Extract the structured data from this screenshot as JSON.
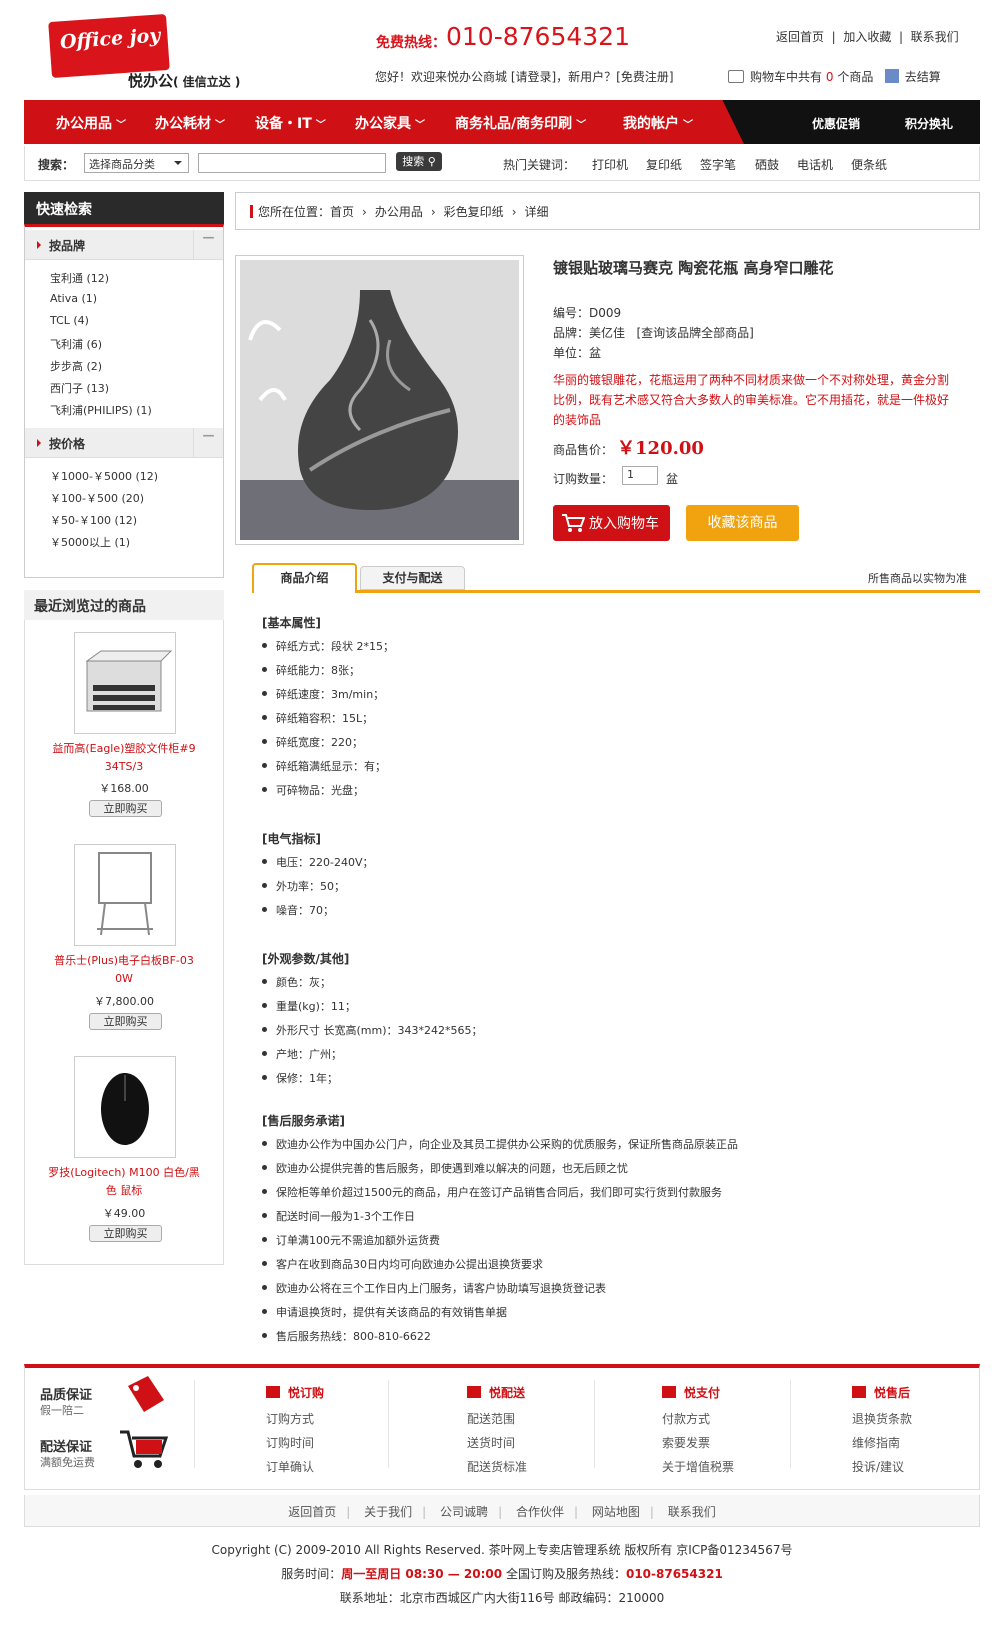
{
  "header": {
    "logo_text": "Office joy",
    "brand": "悦办公",
    "brand_sub": "( 佳信立达 )",
    "hotline_label": "免费热线：",
    "hotline": "010-87654321",
    "top_links": [
      "返回首页",
      "加入收藏",
      "联系我们"
    ],
    "welcome": "您好！欢迎来悦办公商城 [请登录]，新用户？[免费注册]",
    "cart_prefix": "购物车中共有",
    "cart_count": "0",
    "cart_suffix": "个商品",
    "checkout": "去结算"
  },
  "nav": {
    "items": [
      "办公用品",
      "办公耗材",
      "设备・IT",
      "办公家具",
      "商务礼品/商务印刷",
      "我的帐户"
    ],
    "right": [
      "优惠促销",
      "积分换礼"
    ]
  },
  "search": {
    "label": "搜索：",
    "select": "选择商品分类",
    "button": "搜索",
    "hot_label": "热门关键词：",
    "hot": [
      "打印机",
      "复印纸",
      "签字笔",
      "硒鼓",
      "电话机",
      "便条纸"
    ]
  },
  "sidebar": {
    "quick": "快速检索",
    "brand_title": "按品牌",
    "brands": [
      "宝利通 (12)",
      "Ativa (1)",
      "TCL (4)",
      "飞利浦 (6)",
      "步步高 (2)",
      "西门子 (13)",
      "飞利浦(PHILIPS) (1)"
    ],
    "price_title": "按价格",
    "prices": [
      "￥1000-￥5000 (12)",
      "￥100-￥500 (20)",
      "￥50-￥100 (12)",
      "￥5000以上 (1)"
    ],
    "recent_title": "最近浏览过的商品",
    "recent": [
      {
        "name": "益而高(Eagle)塑胶文件柜#9 34TS/3",
        "price": "￥168.00",
        "btn": "立即购买"
      },
      {
        "name": "普乐士(Plus)电子白板BF-03 0W",
        "price": "￥7,800.00",
        "btn": "立即购买"
      },
      {
        "name": "罗技(Logitech) M100 白色/黑色 鼠标",
        "price": "￥49.00",
        "btn": "立即购买"
      }
    ]
  },
  "breadcrumb": {
    "prefix": "您所在位置：",
    "items": [
      "首页",
      "办公用品",
      "彩色复印纸",
      "详细"
    ]
  },
  "product": {
    "title": "镀银贴玻璃马赛克 陶瓷花瓶 高身窄口雕花",
    "code": "编号：D009",
    "brand": "品牌：美亿佳",
    "brand_link": "[查询该品牌全部商品]",
    "unit": "单位：盆",
    "desc": "华丽的镀银雕花，花瓶运用了两种不同材质来做一个不对称处理，黄金分割比例，既有艺术感又符合大多数人的审美标准。它不用插花，就是一件极好的装饰品",
    "price_label": "商品售价：",
    "price": "￥120.00",
    "qty_label": "订购数量：",
    "qty": "1",
    "qty_unit": "盆",
    "cart_btn": "放入购物车",
    "fav_btn": "收藏该商品"
  },
  "tabs": {
    "t1": "商品介绍",
    "t2": "支付与配送",
    "note": "所售商品以实物为准"
  },
  "specs": [
    {
      "title": "[基本属性]",
      "items": [
        "碎纸方式：段状 2*15；",
        "碎纸能力：8张；",
        "碎纸速度：3m/min；",
        "碎纸箱容积：15L；",
        "碎纸宽度：220；",
        "碎纸箱满纸显示：有；",
        "可碎物品：光盘；"
      ]
    },
    {
      "title": "[电气指标]",
      "items": [
        "电压：220-240V；",
        "外功率：50；",
        "噪音：70；"
      ]
    },
    {
      "title": "[外观参数/其他]",
      "items": [
        "颜色：灰；",
        "重量(kg)：11；",
        "外形尺寸 长宽高(mm)：343*242*565；",
        "产地：广州；",
        "保修：1年；"
      ]
    },
    {
      "title": "[售后服务承诺]",
      "items": [
        "欧迪办公作为中国办公门户，向企业及其员工提供办公采购的优质服务，保证所售商品原装正品",
        "欧迪办公提供完善的售后服务，即使遇到难以解决的问题，也无后顾之忧",
        "保险柜等单价超过1500元的商品，用户在签订产品销售合同后，我们即可实行货到付款服务",
        "配送时间一般为1-3个工作日",
        "订单满100元不需追加额外运货费",
        "客户在收到商品30日内均可向欧迪办公提出退换货要求",
        "欧迪办公将在三个工作日内上门服务，请客户协助填写退换货登记表",
        "申请退换货时，提供有关该商品的有效销售单据",
        "售后服务热线：800-810-6622"
      ]
    }
  ],
  "guarantee": {
    "quality": "品质保证",
    "quality_sub": "假一陪二",
    "delivery": "配送保证",
    "delivery_sub": "满额免运费"
  },
  "footer_cols": [
    {
      "title": "悦订购",
      "items": [
        "订购方式",
        "订购时间",
        "订单确认"
      ]
    },
    {
      "title": "悦配送",
      "items": [
        "配送范围",
        "送货时间",
        "配送货标准"
      ]
    },
    {
      "title": "悦支付",
      "items": [
        "付款方式",
        "索要发票",
        "关于增值税票"
      ]
    },
    {
      "title": "悦售后",
      "items": [
        "退换货条款",
        "维修指南",
        "投诉/建议"
      ]
    }
  ],
  "footer_nav": [
    "返回首页",
    "关于我们",
    "公司诚聘",
    "合作伙伴",
    "网站地图",
    "联系我们"
  ],
  "copyright": "Copyright (C) 2009-2010 All Rights Reserved. 茶叶网上专卖店管理系统 版权所有  京ICP备01234567号",
  "service_label": "服务时间：",
  "service_time": "周一至周日 08:30 — 20:00",
  "service_mid": " 全国订购及服务热线：",
  "service_phone": "010-87654321",
  "address": "联系地址：北京市西城区广内大街116号  邮政编码：210000"
}
